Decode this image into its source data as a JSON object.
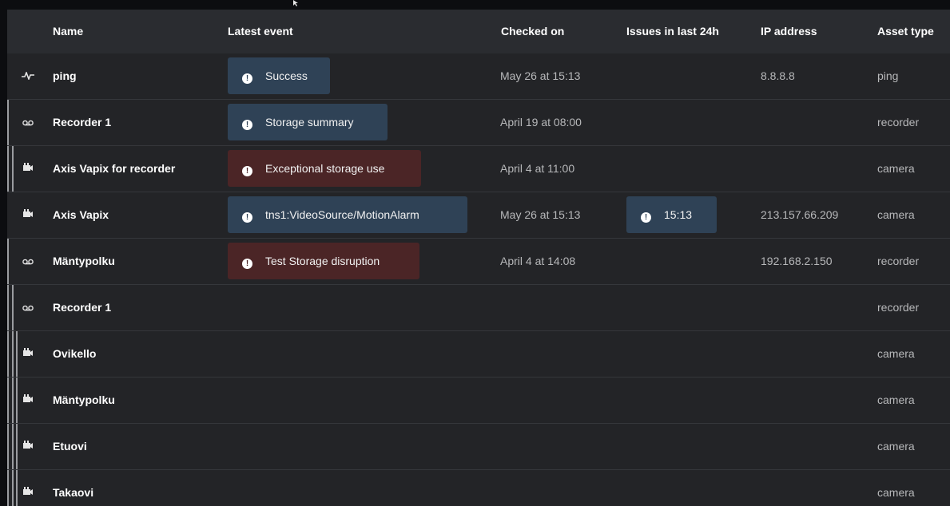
{
  "columns": {
    "name": "Name",
    "latest_event": "Latest event",
    "checked_on": "Checked on",
    "issues": "Issues in last 24h",
    "ip": "IP address",
    "asset_type": "Asset type"
  },
  "rows": [
    {
      "icon": "pulse-icon",
      "name": "ping",
      "event": "Success",
      "event_kind": "info",
      "checked": "May 26 at 15:13",
      "issues": "",
      "ip": "8.8.8.8",
      "type": "ping"
    },
    {
      "icon": "recorder-icon",
      "name": "Recorder 1",
      "event": "Storage summary",
      "event_kind": "info",
      "checked": "April 19 at 08:00",
      "issues": "",
      "ip": "",
      "type": "recorder"
    },
    {
      "icon": "camera-icon",
      "name": "Axis Vapix for recorder",
      "event": "Exceptional storage use",
      "event_kind": "warn",
      "checked": "April 4 at 11:00",
      "issues": "",
      "ip": "",
      "type": "camera"
    },
    {
      "icon": "camera-icon",
      "name": "Axis Vapix",
      "event": "tns1:VideoSource/MotionAlarm",
      "event_kind": "info",
      "checked": "May 26 at 15:13",
      "issues": "15:13",
      "ip": "213.157.66.209",
      "type": "camera"
    },
    {
      "icon": "recorder-icon",
      "name": "Mäntypolku",
      "event": "Test Storage disruption",
      "event_kind": "warn",
      "checked": "April 4 at 14:08",
      "issues": "",
      "ip": "192.168.2.150",
      "type": "recorder"
    },
    {
      "icon": "recorder-icon",
      "name": "Recorder 1",
      "event": "",
      "event_kind": "",
      "checked": "",
      "issues": "",
      "ip": "",
      "type": "recorder"
    },
    {
      "icon": "camera-icon",
      "name": "Ovikello",
      "event": "",
      "event_kind": "",
      "checked": "",
      "issues": "",
      "ip": "",
      "type": "camera"
    },
    {
      "icon": "camera-icon",
      "name": "Mäntypolku",
      "event": "",
      "event_kind": "",
      "checked": "",
      "issues": "",
      "ip": "",
      "type": "camera"
    },
    {
      "icon": "camera-icon",
      "name": "Etuovi",
      "event": "",
      "event_kind": "",
      "checked": "",
      "issues": "",
      "ip": "",
      "type": "camera"
    },
    {
      "icon": "camera-icon",
      "name": "Takaovi",
      "event": "",
      "event_kind": "",
      "checked": "",
      "issues": "",
      "ip": "",
      "type": "camera"
    }
  ],
  "colors": {
    "background": "#232427",
    "header": "#2a2c30",
    "info_badge": "#2f4256",
    "warn_badge": "#4b2526",
    "muted_text": "#b7b8ba"
  }
}
